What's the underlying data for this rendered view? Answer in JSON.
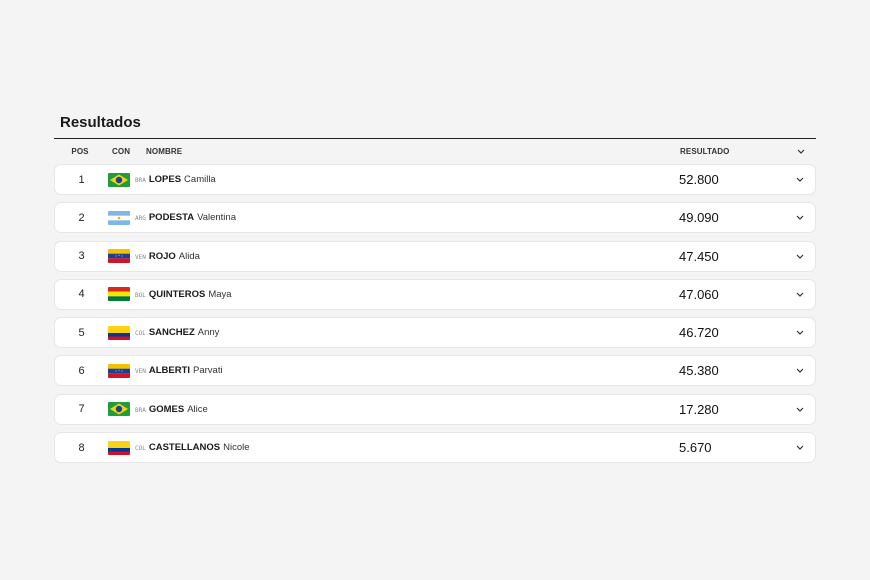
{
  "title": "Resultados",
  "columns": {
    "pos": "POS",
    "con": "CON",
    "name": "NOMBRE",
    "result": "RESULTADO"
  },
  "rows": [
    {
      "pos": "1",
      "country": "BRA",
      "flag": "brazil-flag-icon",
      "last": "LOPES",
      "first": "Camilla",
      "result": "52.800"
    },
    {
      "pos": "2",
      "country": "ARG",
      "flag": "argentina-flag-icon",
      "last": "PODESTA",
      "first": "Valentina",
      "result": "49.090"
    },
    {
      "pos": "3",
      "country": "VEN",
      "flag": "venezuela-flag-icon",
      "last": "ROJO",
      "first": "Alida",
      "result": "47.450"
    },
    {
      "pos": "4",
      "country": "BOL",
      "flag": "bolivia-flag-icon",
      "last": "QUINTEROS",
      "first": "Maya",
      "result": "47.060"
    },
    {
      "pos": "5",
      "country": "COL",
      "flag": "colombia-flag-icon",
      "last": "SANCHEZ",
      "first": "Anny",
      "result": "46.720"
    },
    {
      "pos": "6",
      "country": "VEN",
      "flag": "venezuela-flag-icon",
      "last": "ALBERTI",
      "first": "Parvati",
      "result": "45.380"
    },
    {
      "pos": "7",
      "country": "BRA",
      "flag": "brazil-flag-icon",
      "last": "GOMES",
      "first": "Alice",
      "result": "17.280"
    },
    {
      "pos": "8",
      "country": "COL",
      "flag": "colombia-flag-icon",
      "last": "CASTELLANOS",
      "first": "Nicole",
      "result": "5.670"
    }
  ]
}
